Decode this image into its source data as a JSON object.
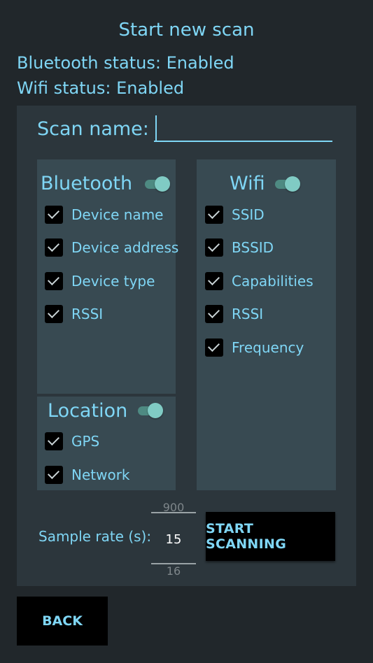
{
  "header": {
    "title": "Start new scan",
    "bluetooth_status": "Bluetooth status: Enabled",
    "wifi_status": "Wifi status: Enabled"
  },
  "form": {
    "scan_name_label": "Scan name:",
    "scan_name_value": ""
  },
  "bluetooth": {
    "title": "Bluetooth",
    "enabled": true,
    "items": [
      {
        "label": "Device name",
        "checked": true
      },
      {
        "label": "Device address",
        "checked": true
      },
      {
        "label": "Device type",
        "checked": true
      },
      {
        "label": "RSSI",
        "checked": true
      }
    ]
  },
  "wifi": {
    "title": "Wifi",
    "enabled": true,
    "items": [
      {
        "label": "SSID",
        "checked": true
      },
      {
        "label": "BSSID",
        "checked": true
      },
      {
        "label": "Capabilities",
        "checked": true
      },
      {
        "label": "RSSI",
        "checked": true
      },
      {
        "label": "Frequency",
        "checked": true
      }
    ]
  },
  "location": {
    "title": "Location",
    "enabled": true,
    "items": [
      {
        "label": "GPS",
        "checked": true
      },
      {
        "label": "Network",
        "checked": true
      }
    ]
  },
  "sample_rate": {
    "label": "Sample rate (s):",
    "previous": "900",
    "current": "15",
    "next": "16"
  },
  "buttons": {
    "start": "START SCANNING",
    "back": "BACK"
  },
  "colors": {
    "background": "#21272b",
    "card": "#2c363c",
    "panel": "#384a52",
    "accent_text": "#7fd6f5",
    "switch_thumb": "#80cbc4",
    "button": "#000000"
  }
}
